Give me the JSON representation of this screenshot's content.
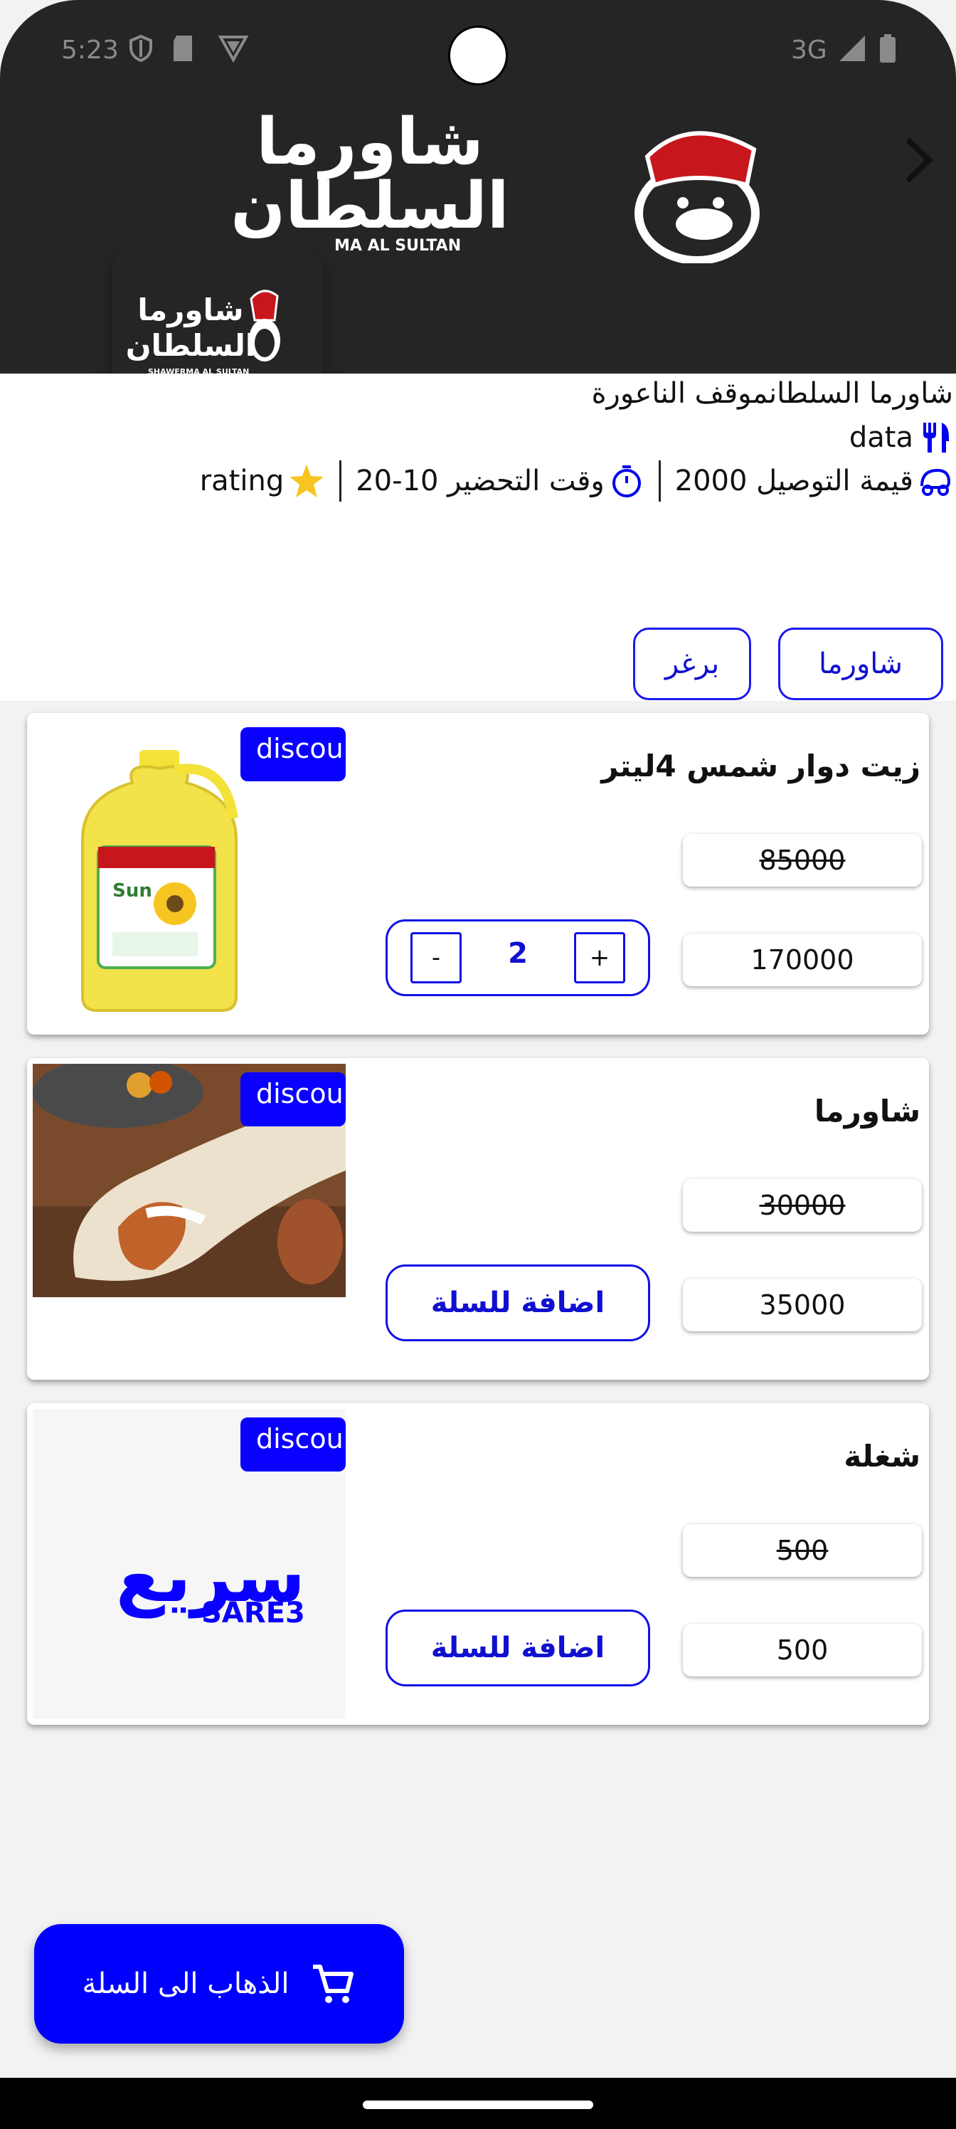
{
  "status_bar": {
    "time": "5:23",
    "network": "3G"
  },
  "restaurant": {
    "name": "شاورما السلطانموقف الناعورة",
    "type_label": "data",
    "delivery_label": "قيمة التوصيل 2000",
    "prep_label": "وقت التحضير 10-20",
    "rating_label": "rating",
    "logo_line1": "شاورما",
    "logo_line2": "السلطان",
    "logo_caption": "SHAWERMA AL SULTAN",
    "banner_caption": "MA AL SULTAN"
  },
  "categories": [
    "شاورما",
    "برغر"
  ],
  "products": [
    {
      "title": "زيت دوار شمس 4ليتر",
      "old_price": "85000",
      "price": "170000",
      "badge": "discount",
      "quantity": "2",
      "plus": "+",
      "minus": "-",
      "image_text": "Sun"
    },
    {
      "title": "شاورما",
      "old_price": "30000",
      "price": "35000",
      "badge": "discount",
      "add_label": "اضافة للسلة"
    },
    {
      "title": "شغلة",
      "old_price": "500",
      "price": "500",
      "badge": "discount",
      "add_label": "اضافة للسلة",
      "image_text": "SARE3",
      "image_text_ar": "سريع"
    }
  ],
  "cart_button": {
    "label": "الذهاب الى السلة"
  },
  "colors": {
    "accent": "#0000ff",
    "banner": "#252525",
    "logo_red": "#c8161d"
  }
}
